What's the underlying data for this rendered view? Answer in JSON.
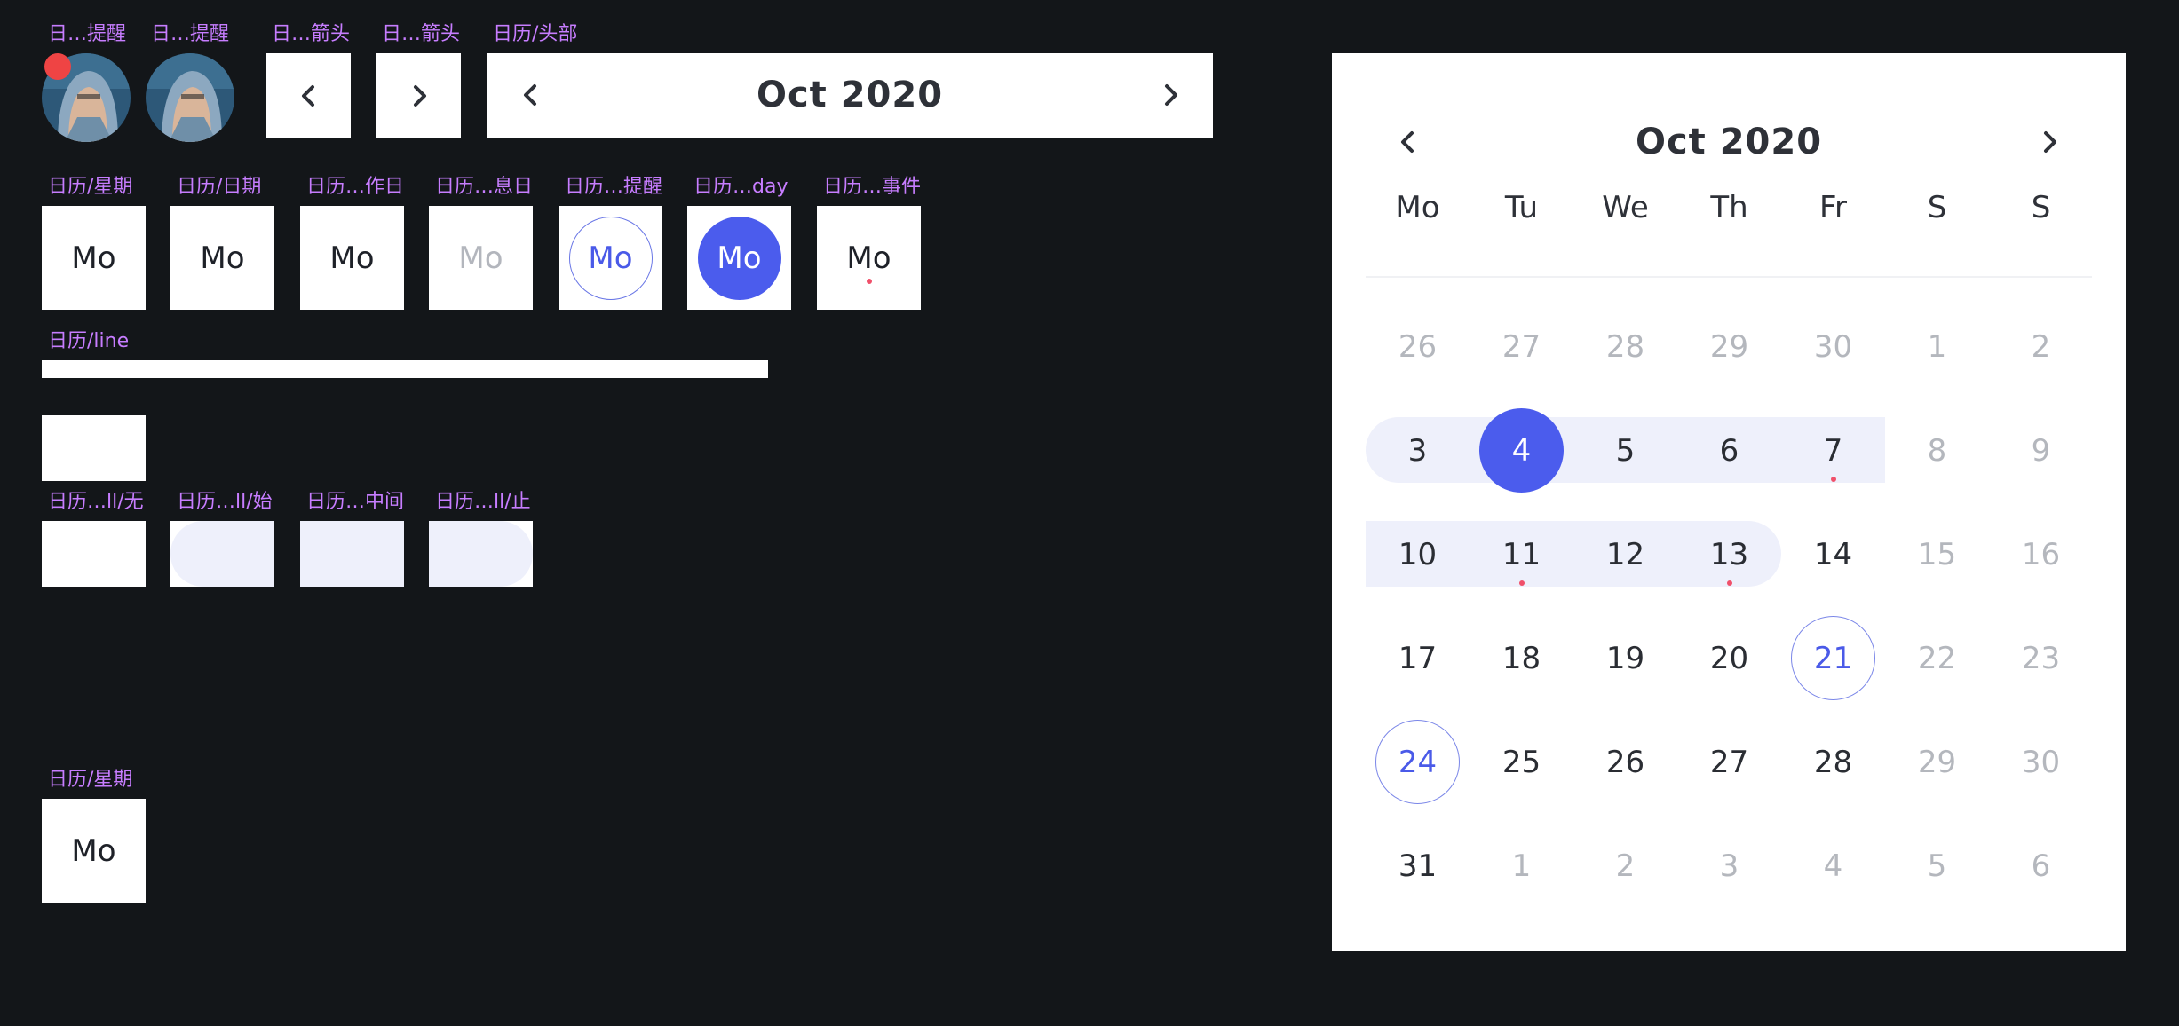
{
  "labels": {
    "avatar1": "日…提醒",
    "avatar2": "日…提醒",
    "arrow_left": "日…箭头",
    "arrow_right": "日…箭头",
    "header": "日历/头部",
    "weekday": "日历/星期",
    "date": "日历/日期",
    "workday": "日历…作日",
    "restday": "日历…息日",
    "reminder": "日历…提醒",
    "today": "日历…day",
    "event": "日历…事件",
    "line": "日历/line",
    "range_none": "日历…ll/无",
    "range_start": "日历…ll/始",
    "range_middle": "日历…中间",
    "range_end": "日历…ll/止",
    "weekday2": "日历/星期"
  },
  "colors": {
    "accent": "#4b5ced",
    "range_fill": "#eef0fb",
    "event_dot": "#f0506a",
    "label": "#c77dff",
    "background": "#131619"
  },
  "header_component": {
    "title": "Oct 2020",
    "prev_icon": "chevron-left-icon",
    "next_icon": "chevron-right-icon"
  },
  "cells": {
    "weekday": "Mo",
    "date": "Mo",
    "workday": "Mo",
    "restday": "Mo",
    "reminder": "Mo",
    "today": "Mo",
    "event": "Mo",
    "weekday2": "Mo"
  },
  "calendar": {
    "title": "Oct 2020",
    "weekdays": [
      "Mo",
      "Tu",
      "We",
      "Th",
      "Fr",
      "S",
      "S"
    ],
    "rows": [
      [
        "26",
        "27",
        "28",
        "29",
        "30",
        "1",
        "2"
      ],
      [
        "3",
        "4",
        "5",
        "6",
        "7",
        "8",
        "9"
      ],
      [
        "10",
        "11",
        "12",
        "13",
        "14",
        "15",
        "16"
      ],
      [
        "17",
        "18",
        "19",
        "20",
        "21",
        "22",
        "23"
      ],
      [
        "24",
        "25",
        "26",
        "27",
        "28",
        "29",
        "30"
      ],
      [
        "31",
        "1",
        "2",
        "3",
        "4",
        "5",
        "6"
      ]
    ],
    "selected_day": "4",
    "ringed_days": [
      "21",
      "24"
    ],
    "event_days": [
      "7",
      "11",
      "13"
    ],
    "range": "3 – 13"
  }
}
